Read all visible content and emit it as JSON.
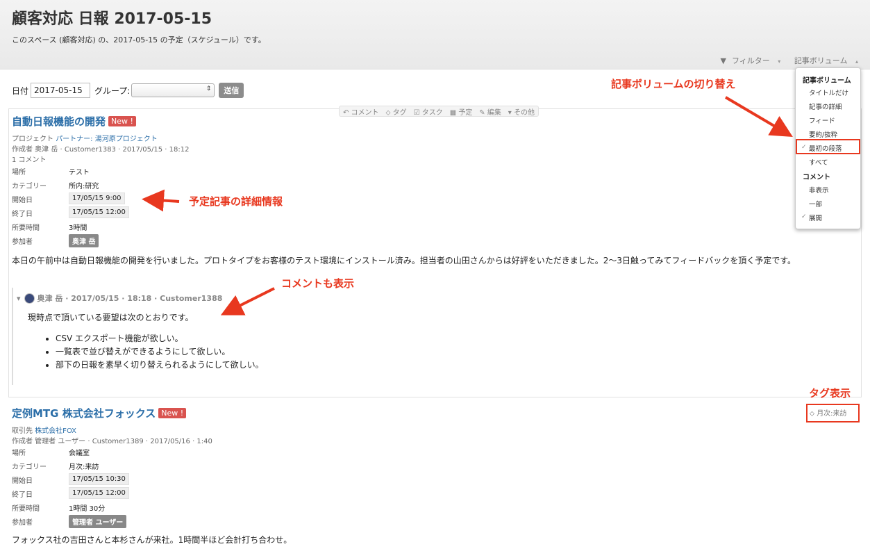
{
  "header": {
    "title": "顧客対応 日報 2017-05-15",
    "subtitle": "このスペース (顧客対応) の、2017-05-15 の予定（スケジュール）です。",
    "filter_label": "フィルター",
    "volume_label": "記事ボリューム"
  },
  "form": {
    "date_label": "日付",
    "date_value": "2017-05-15",
    "group_label": "グループ:",
    "group_value": "",
    "submit_label": "送信"
  },
  "toolbar": {
    "comment": "コメント",
    "tag": "タグ",
    "task": "タスク",
    "schedule": "予定",
    "edit": "編集",
    "other": "その他"
  },
  "dropdown": {
    "heading_volume": "記事ボリューム",
    "volume_items": [
      "タイトルだけ",
      "記事の詳細",
      "フィード",
      "要約/抜粋",
      "最初の段落",
      "すべて"
    ],
    "volume_selected": "最初の段落",
    "heading_comment": "コメント",
    "comment_items": [
      "非表示",
      "一部",
      "展開"
    ],
    "comment_selected": "展開"
  },
  "entries": [
    {
      "title": "自動日報機能の開発",
      "badge": "New !",
      "project_label": "プロジェクト",
      "project_value": "パートナー: 湯河原プロジェクト",
      "author_line": "作成者 奥津 岳 · Customer1383 · 2017/05/15 · 18:12",
      "comment_count": "1 コメント",
      "fields": {
        "place_label": "場所",
        "place": "テスト",
        "category_label": "カテゴリー",
        "category": "所内:研究",
        "start_label": "開始日",
        "start": "17/05/15 9:00",
        "end_label": "終了日",
        "end": "17/05/15 12:00",
        "duration_label": "所要時間",
        "duration": "3時間",
        "participants_label": "参加者",
        "participant": "奥津 岳"
      },
      "body": "本日の午前中は自動日報機能の開発を行いました。プロトタイプをお客様のテスト環境にインストール済み。担当者の山田さんからは好評をいただきました。2〜3日触ってみてフィードバックを頂く予定です。",
      "comment": {
        "header": "奥津 岳 · 2017/05/15 · 18:18 · Customer1388",
        "text": "現時点で頂いている要望は次のとおりです。",
        "bullets": [
          "CSV エクスポート機能が欲しい。",
          "一覧表で並び替えができるようにして欲しい。",
          "部下の日報を素早く切り替えられるようにして欲しい。"
        ]
      }
    },
    {
      "title": "定例MTG 株式会社フォックス",
      "badge": "New !",
      "client_label": "取引先",
      "client_value": "株式会社FOX",
      "author_line": "作成者 管理者 ユーザー · Customer1389 · 2017/05/16 · 1:40",
      "tag": "月次:来訪",
      "fields": {
        "place_label": "場所",
        "place": "会議室",
        "category_label": "カテゴリー",
        "category": "月次:来訪",
        "start_label": "開始日",
        "start": "17/05/15 10:30",
        "end_label": "終了日",
        "end": "17/05/15 12:00",
        "duration_label": "所要時間",
        "duration": "1時間 30分",
        "participants_label": "参加者",
        "participant": "管理者 ユーザー"
      },
      "body": "フォックス社の吉田さんと本杉さんが来社。1時間半ほど会計打ち合わせ。"
    }
  ],
  "annotations": {
    "volume_switch": "記事ボリュームの切り替え",
    "schedule_detail": "予定記事の詳細情報",
    "comment_display": "コメントも表示",
    "tag_display": "タグ表示"
  },
  "colors": {
    "accent_red": "#e8381f",
    "link_blue": "#2b6ea8",
    "badge_red": "#d9534f"
  }
}
